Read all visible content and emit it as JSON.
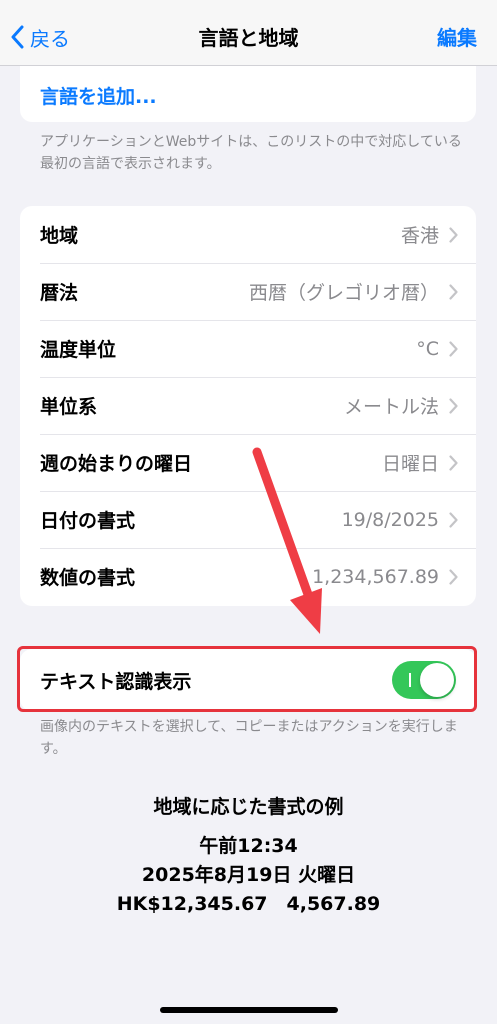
{
  "nav": {
    "back_label": "戻る",
    "title": "言語と地域",
    "edit_label": "編集"
  },
  "languages": {
    "add_label": "言語を追加..."
  },
  "language_note": "アプリケーションとWebサイトは、このリストの中で対応している最初の言語で表示されます。",
  "settings": [
    {
      "label": "地域",
      "value": "香港"
    },
    {
      "label": "暦法",
      "value": "西暦（グレゴリオ暦）"
    },
    {
      "label": "温度単位",
      "value": "°C"
    },
    {
      "label": "単位系",
      "value": "メートル法"
    },
    {
      "label": "週の始まりの曜日",
      "value": "日曜日"
    },
    {
      "label": "日付の書式",
      "value": "19/8/2025"
    },
    {
      "label": "数値の書式",
      "value": "1,234,567.89"
    }
  ],
  "live_text": {
    "label": "テキスト認識表示",
    "enabled": true,
    "note": "画像内のテキストを選択して、コピーまたはアクションを実行します。"
  },
  "format_example": {
    "title": "地域に応じた書式の例",
    "time": "午前12:34",
    "date": "2025年8月19日 火曜日",
    "numbers": "HK$12,345.67　4,567.89"
  },
  "colors": {
    "accent": "#0a7aff",
    "toggle_on": "#34c759",
    "annotation": "#e6333c",
    "background": "#f2f2f7"
  }
}
